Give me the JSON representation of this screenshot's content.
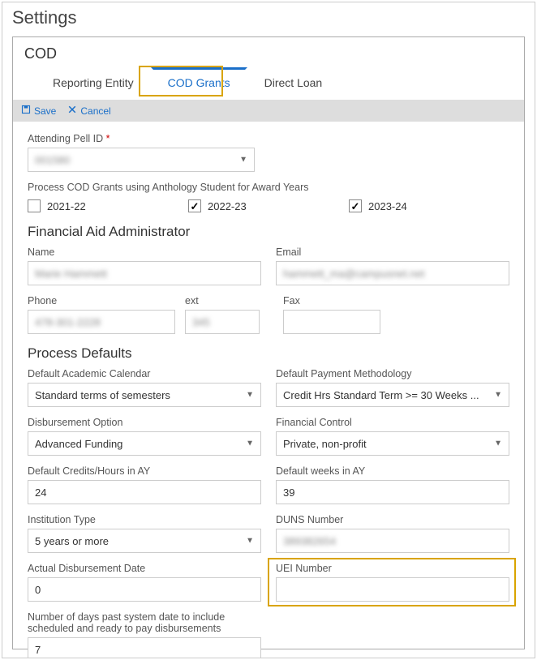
{
  "page_title": "Settings",
  "panel_title": "COD",
  "tabs": {
    "reporting": "Reporting Entity",
    "codgrants": "COD Grants",
    "directloan": "Direct Loan"
  },
  "toolbar": {
    "save": "Save",
    "cancel": "Cancel"
  },
  "attending_pell": {
    "label": "Attending Pell ID",
    "value": "001580"
  },
  "process_cod_label": "Process COD Grants using Anthology Student for Award Years",
  "award_years": {
    "y2021": "2021-22",
    "y2022": "2022-23",
    "y2023": "2023-24"
  },
  "fa_admin": {
    "title": "Financial Aid Administrator",
    "name_label": "Name",
    "name_value": "Marie Hammett",
    "email_label": "Email",
    "email_value": "hammett_ma@campusnet.net",
    "phone_label": "Phone",
    "phone_value": "478-301-2228",
    "ext_label": "ext",
    "ext_value": "345",
    "fax_label": "Fax",
    "fax_value": ""
  },
  "process_defaults": {
    "title": "Process Defaults",
    "academic_calendar_label": "Default Academic Calendar",
    "academic_calendar_value": "Standard terms of semesters",
    "payment_methodology_label": "Default Payment Methodology",
    "payment_methodology_value": "Credit Hrs Standard Term >= 30 Weeks ...",
    "disbursement_option_label": "Disbursement Option",
    "disbursement_option_value": "Advanced Funding",
    "financial_control_label": "Financial Control",
    "financial_control_value": "Private, non-profit",
    "credits_label": "Default Credits/Hours in AY",
    "credits_value": "24",
    "weeks_label": "Default weeks in AY",
    "weeks_value": "39",
    "institution_type_label": "Institution Type",
    "institution_type_value": "5 years or more",
    "duns_label": "DUNS Number",
    "duns_value": "389382654",
    "actual_disb_label": "Actual Disbursement Date",
    "actual_disb_value": "0",
    "uei_label": "UEI Number",
    "uei_value": "",
    "days_past_label": "Number of days past system date to include scheduled and ready to pay disbursements",
    "days_past_value": "7"
  }
}
